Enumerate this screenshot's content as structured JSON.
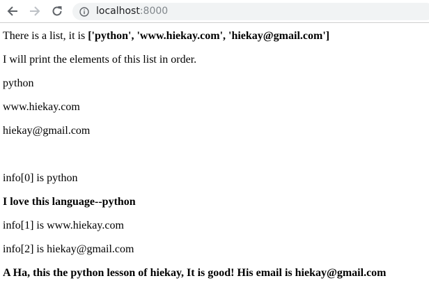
{
  "browser": {
    "host": "localhost",
    "port": ":8000"
  },
  "page": {
    "intro_prefix": "There is a list, it is ",
    "intro_list": "['python', 'www.hiekay.com', 'hiekay@gmail.com']",
    "print_notice": "I will print the elements of this list in order.",
    "items": [
      "python",
      "www.hiekay.com",
      "hiekay@gmail.com"
    ],
    "index_line_0": "info[0] is python",
    "love_line": "I love this language--python",
    "index_line_1": "info[1] is www.hiekay.com",
    "index_line_2": "info[2] is hiekay@gmail.com",
    "closing_line": "A Ha, this the python lesson of hiekay, It is good! His email is hiekay@gmail.com"
  }
}
